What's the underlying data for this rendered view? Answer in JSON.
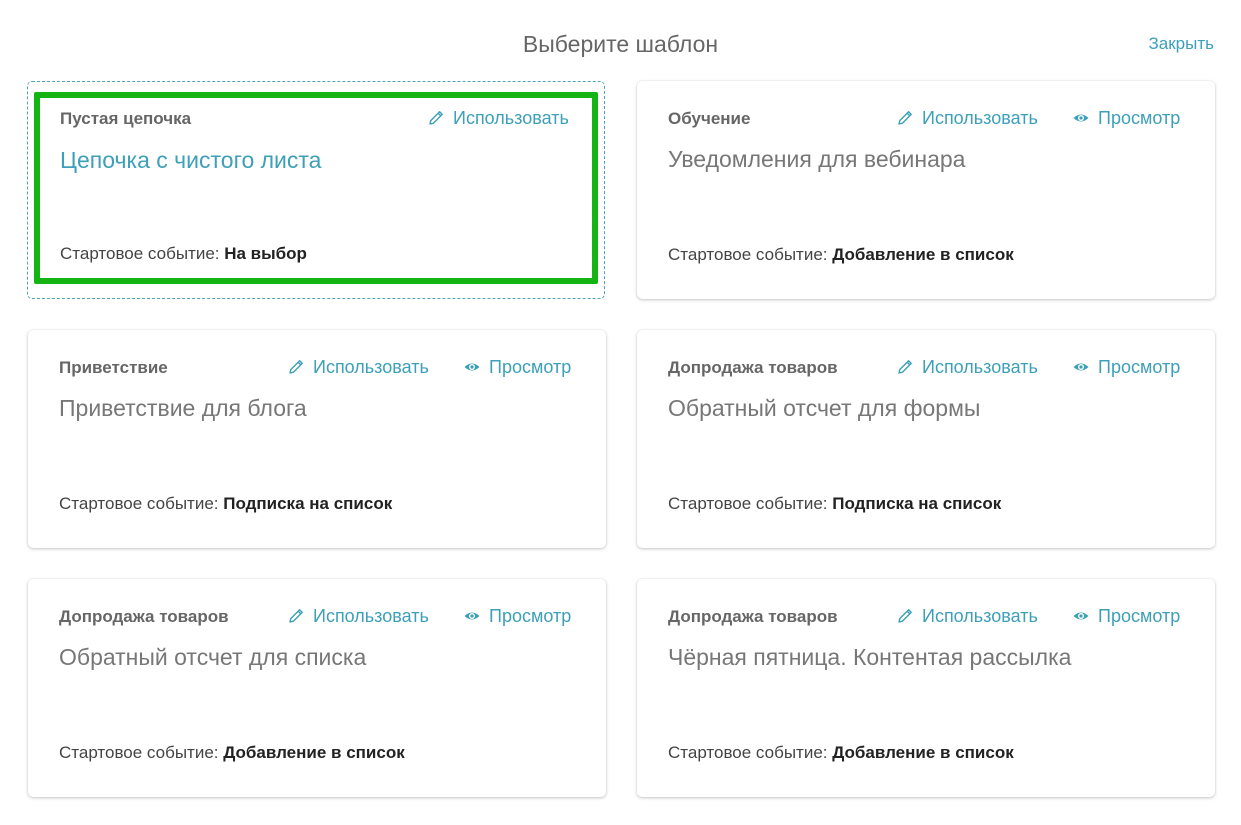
{
  "header": {
    "title": "Выберите шаблон",
    "close_label": "Закрыть"
  },
  "labels": {
    "use": "Использовать",
    "view": "Просмотр",
    "start_event": "Стартовое событие: "
  },
  "colors": {
    "accent": "#3d9fb8",
    "selected_frame": "#13b413"
  },
  "cards": [
    {
      "category": "Пустая цепочка",
      "name": "Цепочка с чистого листа",
      "event": "На выбор",
      "selected": true,
      "has_view": false
    },
    {
      "category": "Обучение",
      "name": "Уведомления для вебинара",
      "event": "Добавление в список",
      "selected": false,
      "has_view": true
    },
    {
      "category": "Приветствие",
      "name": "Приветствие для блога",
      "event": "Подписка на список",
      "selected": false,
      "has_view": true
    },
    {
      "category": "Допродажа товаров",
      "name": "Обратный отсчет для формы",
      "event": "Подписка на список",
      "selected": false,
      "has_view": true
    },
    {
      "category": "Допродажа товаров",
      "name": "Обратный отсчет для списка",
      "event": "Добавление в список",
      "selected": false,
      "has_view": true
    },
    {
      "category": "Допродажа товаров",
      "name": "Чёрная пятница. Контентая рассылка",
      "event": "Добавление в список",
      "selected": false,
      "has_view": true
    }
  ]
}
